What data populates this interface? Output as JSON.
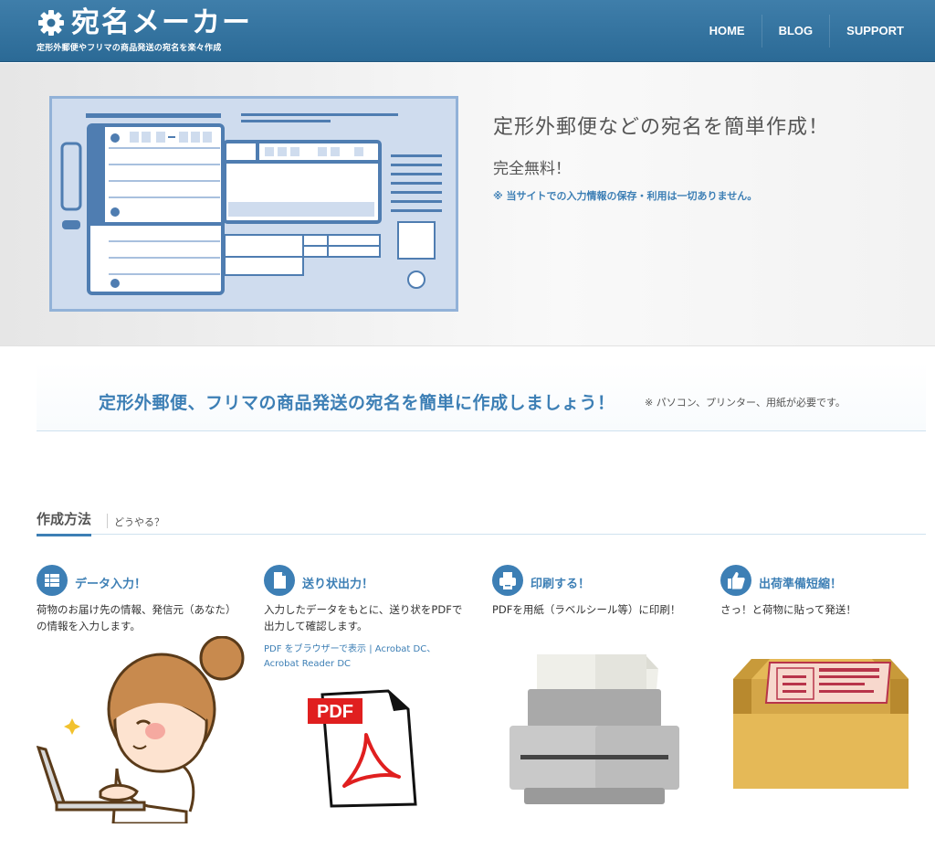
{
  "header": {
    "logo_title": "宛名メーカー",
    "logo_subtitle": "定形外郵便やフリマの商品発送の宛名を楽々作成",
    "nav": [
      "HOME",
      "BLOG",
      "SUPPORT"
    ],
    "brand_color": "#2f6f9c"
  },
  "hero": {
    "title": "定形外郵便などの宛名を簡単作成！",
    "free": "完全無料！",
    "note": "※ 当サイトでの入力情報の保存・利用は一切ありません。"
  },
  "tagline": {
    "main": "定形外郵便、フリマの商品発送の宛名を簡単に作成しましょう！",
    "note": "※ パソコン、プリンター、用紙が必要です。"
  },
  "howto": {
    "title": "作成方法",
    "subtitle": "どうやる？",
    "steps": [
      {
        "icon": "table-icon",
        "title": "データ入力！",
        "desc": "荷物のお届け先の情報、発信元（あなた）の情報を入力します。"
      },
      {
        "icon": "document-icon",
        "title": "送り状出力！",
        "desc": "入力したデータをもとに、送り状をPDFで出力して確認します。",
        "link": "PDF をブラウザーで表示 | Acrobat DC、Acrobat Reader DC"
      },
      {
        "icon": "printer-icon",
        "title": "印刷する！",
        "desc": "PDFを用紙（ラベルシール等）に印刷！"
      },
      {
        "icon": "thumbs-up-icon",
        "title": "出荷準備短縮！",
        "desc": "さっ！と荷物に貼って発送！"
      }
    ]
  },
  "pdf_label": "PDF",
  "accent_color": "#3d7fb5"
}
